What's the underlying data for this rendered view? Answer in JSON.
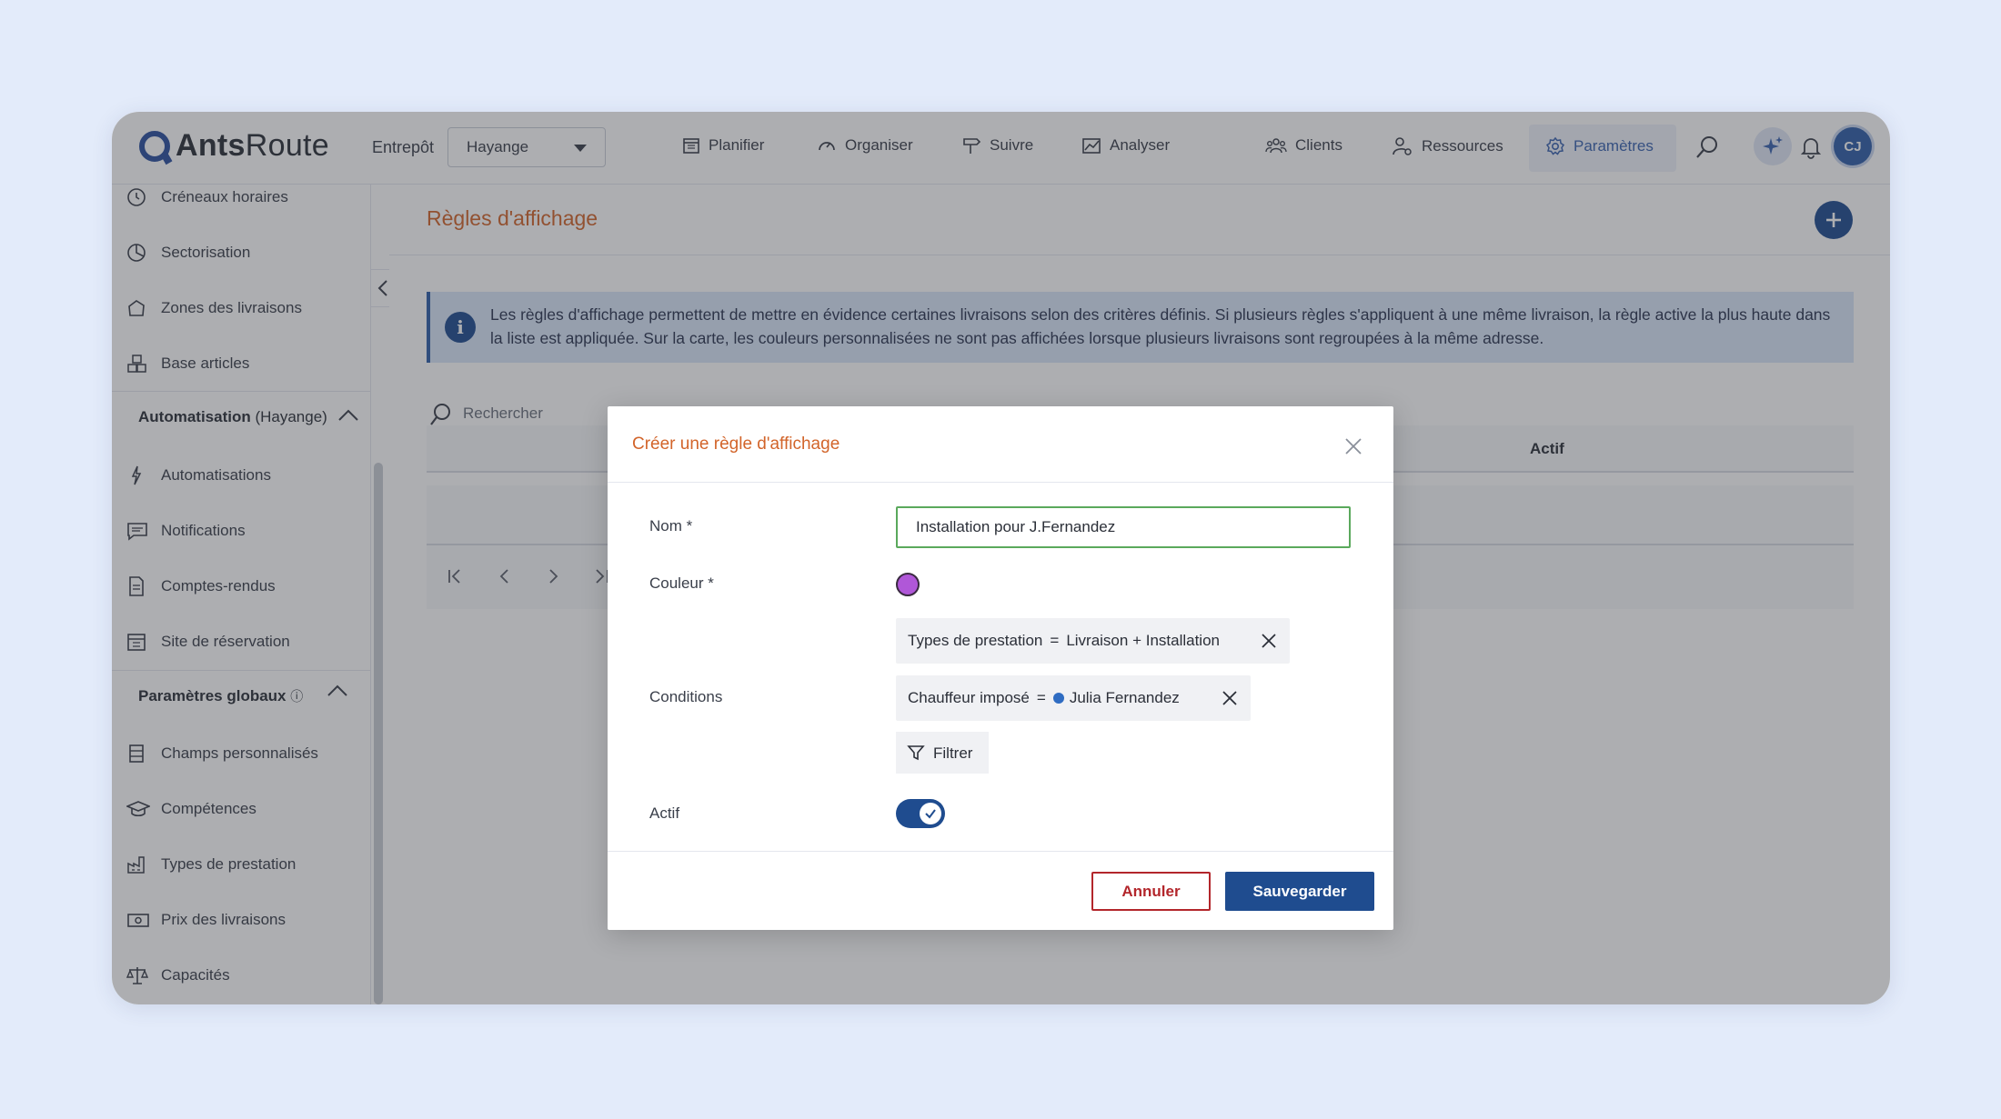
{
  "app": {
    "logo_bold": "Ants",
    "logo_light": "Route"
  },
  "warehouse": {
    "label": "Entrepôt",
    "value": "Hayange"
  },
  "nav": {
    "planifier": "Planifier",
    "organiser": "Organiser",
    "suivre": "Suivre",
    "analyser": "Analyser",
    "clients": "Clients",
    "ressources": "Ressources",
    "parametres": "Paramètres"
  },
  "user": {
    "initials": "CJ"
  },
  "sidebar": {
    "items_top": [
      {
        "label": "Créneaux horaires",
        "icon": "clock-icon"
      },
      {
        "label": "Sectorisation",
        "icon": "pie-chart-icon"
      },
      {
        "label": "Zones des livraisons",
        "icon": "zone-icon"
      },
      {
        "label": "Base articles",
        "icon": "boxes-icon"
      }
    ],
    "section_auto": {
      "title_bold": "Automatisation",
      "title_rest": " (Hayange)"
    },
    "items_auto": [
      {
        "label": "Automatisations",
        "icon": "bolt-icon"
      },
      {
        "label": "Notifications",
        "icon": "message-icon"
      },
      {
        "label": "Comptes-rendus",
        "icon": "document-icon"
      },
      {
        "label": "Site de réservation",
        "icon": "calendar-icon"
      }
    ],
    "section_global": {
      "title_bold": "Paramètres globaux",
      "info": "ⓘ"
    },
    "items_global": [
      {
        "label": "Champs personnalisés",
        "icon": "fields-icon"
      },
      {
        "label": "Compétences",
        "icon": "graduation-cap-icon"
      },
      {
        "label": "Types de prestation",
        "icon": "factory-icon"
      },
      {
        "label": "Prix des livraisons",
        "icon": "money-icon"
      },
      {
        "label": "Capacités",
        "icon": "scale-icon"
      }
    ]
  },
  "page": {
    "title": "Règles d'affichage",
    "info": "Les règles d'affichage permettent de mettre en évidence certaines livraisons selon des critères définis. Si plusieurs règles s'appliquent à une même livraison, la règle active la plus haute dans la liste est appliquée. Sur la carte, les couleurs personnalisées ne sont pas affichées lorsque plusieurs livraisons sont regroupées à la même adresse.",
    "search_placeholder": "Rechercher",
    "table_col_actif": "Actif"
  },
  "modal": {
    "title": "Créer une règle d'affichage",
    "name_label": "Nom *",
    "name_value": "Installation pour J.Fernandez",
    "color_label": "Couleur *",
    "color_value": "#b057d8",
    "conditions_label": "Conditions",
    "conditions": [
      {
        "field": "Types de prestation",
        "op": "=",
        "value": "Livraison + Installation"
      },
      {
        "field": "Chauffeur imposé",
        "op": "=",
        "value": "Julia Fernandez"
      }
    ],
    "filter_label": "Filtrer",
    "active_label": "Actif",
    "active": true,
    "cancel_label": "Annuler",
    "save_label": "Sauvegarder"
  },
  "colors": {
    "accent": "#1f4c8f",
    "title_orange": "#d2642a",
    "danger": "#b3262b"
  }
}
